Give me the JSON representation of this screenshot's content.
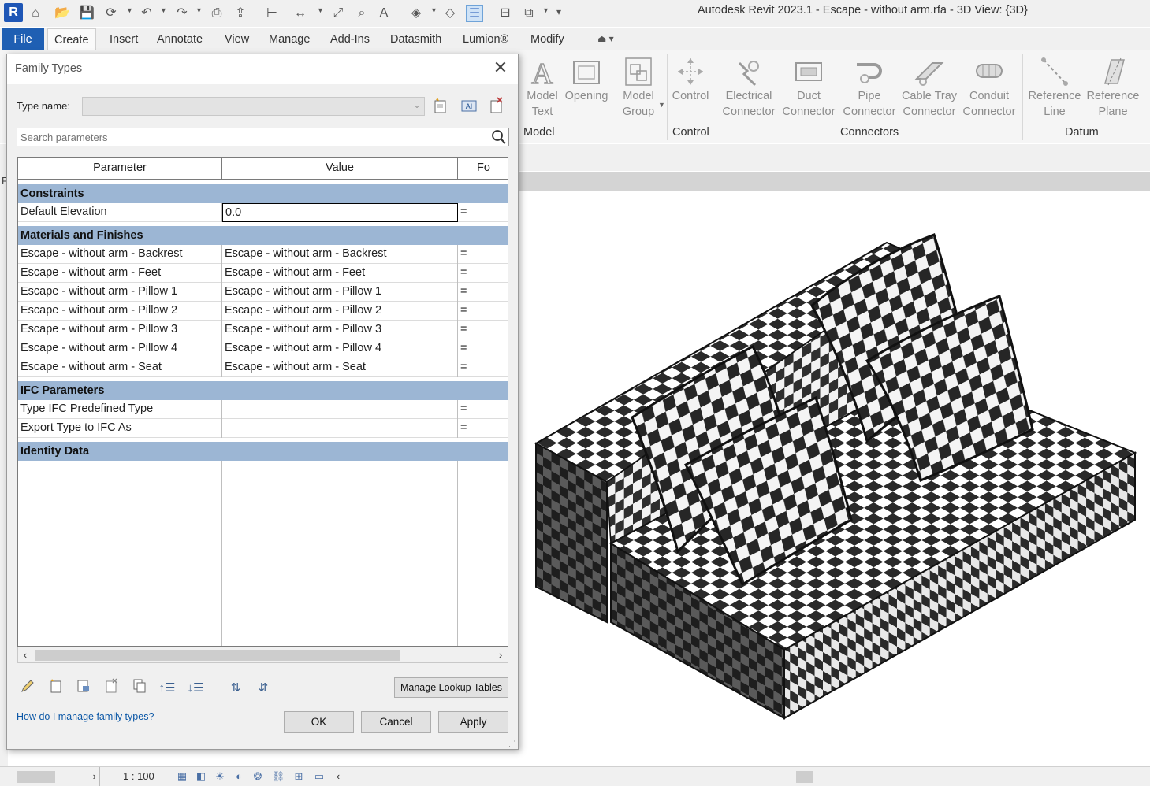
{
  "app": {
    "title": "Autodesk Revit 2023.1 - Escape - without arm.rfa - 3D View: {3D}",
    "logo_letter": "R"
  },
  "ribbon_tabs": [
    "File",
    "Create",
    "Insert",
    "Annotate",
    "View",
    "Manage",
    "Add-Ins",
    "Datasmith",
    "Lumion®",
    "Modify"
  ],
  "ribbon": {
    "buttons": [
      {
        "l1": "Model",
        "l2": "Text",
        "icon": "model-text-icon"
      },
      {
        "l1": "Opening",
        "l2": "",
        "icon": "opening-icon"
      },
      {
        "l1": "Model",
        "l2": "Group",
        "icon": "model-group-icon"
      },
      {
        "l1": "Control",
        "l2": "",
        "icon": "control-icon"
      },
      {
        "l1": "Electrical",
        "l2": "Connector",
        "icon": "electrical-connector-icon"
      },
      {
        "l1": "Duct",
        "l2": "Connector",
        "icon": "duct-connector-icon"
      },
      {
        "l1": "Pipe",
        "l2": "Connector",
        "icon": "pipe-connector-icon"
      },
      {
        "l1": "Cable Tray",
        "l2": "Connector",
        "icon": "cable-tray-connector-icon"
      },
      {
        "l1": "Conduit",
        "l2": "Connector",
        "icon": "conduit-connector-icon"
      },
      {
        "l1": "Reference",
        "l2": "Line",
        "icon": "reference-line-icon"
      },
      {
        "l1": "Reference",
        "l2": "Plane",
        "icon": "reference-plane-icon"
      }
    ],
    "panels": [
      "Model",
      "Control",
      "Connectors",
      "Datum"
    ]
  },
  "left_strip_letter": "P",
  "dialog": {
    "title": "Family Types",
    "type_name_label": "Type name:",
    "type_name_value": "",
    "search_placeholder": "Search parameters",
    "columns": [
      "Parameter",
      "Value",
      "Fo"
    ],
    "groups": [
      {
        "name": "Constraints",
        "rows": [
          {
            "param": "Default Elevation",
            "value": "0.0",
            "formula": "="
          }
        ]
      },
      {
        "name": "Materials and Finishes",
        "rows": [
          {
            "param": "Escape - without arm - Backrest",
            "value": "Escape - without arm - Backrest",
            "formula": "="
          },
          {
            "param": "Escape - without arm - Feet",
            "value": "Escape - without arm - Feet",
            "formula": "="
          },
          {
            "param": "Escape - without arm - Pillow 1",
            "value": "Escape - without arm - Pillow 1",
            "formula": "="
          },
          {
            "param": "Escape - without arm - Pillow 2",
            "value": "Escape - without arm - Pillow 2",
            "formula": "="
          },
          {
            "param": "Escape - without arm - Pillow 3",
            "value": "Escape - without arm - Pillow 3",
            "formula": "="
          },
          {
            "param": "Escape - without arm - Pillow 4",
            "value": "Escape - without arm - Pillow 4",
            "formula": "="
          },
          {
            "param": "Escape - without arm - Seat",
            "value": "Escape - without arm - Seat",
            "formula": "="
          }
        ]
      },
      {
        "name": "IFC Parameters",
        "rows": [
          {
            "param": "Type IFC Predefined Type",
            "value": "",
            "formula": "="
          },
          {
            "param": "Export Type to IFC As",
            "value": "",
            "formula": "="
          }
        ]
      },
      {
        "name": "Identity Data",
        "rows": []
      }
    ],
    "buttons": {
      "lookup": "Manage Lookup Tables",
      "ok": "OK",
      "cancel": "Cancel",
      "apply": "Apply"
    },
    "help_link": "How do I manage family types?"
  },
  "statusbar": {
    "scale": "1 : 100"
  },
  "colors": {
    "file_tab": "#1f5fb3",
    "group_row": "#9cb6d4",
    "link": "#0b57a6"
  }
}
